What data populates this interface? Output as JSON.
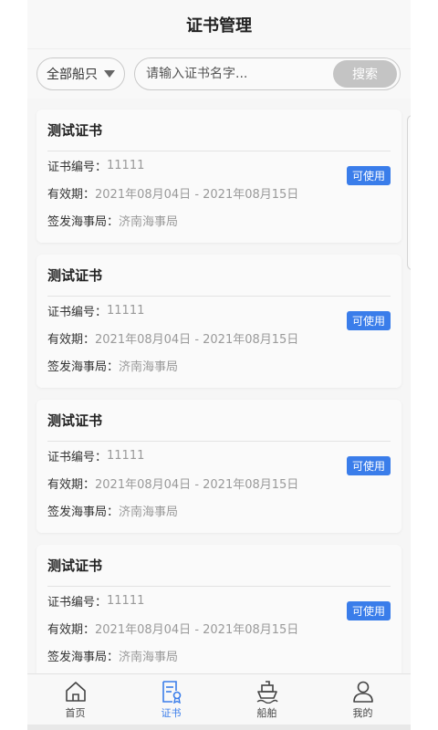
{
  "header": {
    "title": "证书管理"
  },
  "filter": {
    "ship_select": "全部船只",
    "search_placeholder": "请输入证书名字...",
    "search_button": "搜索"
  },
  "certificates": [
    {
      "title": "测试证书",
      "number_label": "证书编号：",
      "number": "11111",
      "validity_label": "有效期：",
      "validity": "2021年08月04日 - 2021年08月15日",
      "issuer_label": "签发海事局：",
      "issuer": "济南海事局",
      "status": "可使用"
    },
    {
      "title": "测试证书",
      "number_label": "证书编号：",
      "number": "11111",
      "validity_label": "有效期：",
      "validity": "2021年08月04日 - 2021年08月15日",
      "issuer_label": "签发海事局：",
      "issuer": "济南海事局",
      "status": "可使用"
    },
    {
      "title": "测试证书",
      "number_label": "证书编号：",
      "number": "11111",
      "validity_label": "有效期：",
      "validity": "2021年08月04日 - 2021年08月15日",
      "issuer_label": "签发海事局：",
      "issuer": "济南海事局",
      "status": "可使用"
    },
    {
      "title": "测试证书",
      "number_label": "证书编号：",
      "number": "11111",
      "validity_label": "有效期：",
      "validity": "2021年08月04日 - 2021年08月15日",
      "issuer_label": "签发海事局：",
      "issuer": "济南海事局",
      "status": "可使用"
    }
  ],
  "tabs": [
    {
      "label": "首页",
      "icon": "home-icon",
      "active": false
    },
    {
      "label": "证书",
      "icon": "certificate-icon",
      "active": true
    },
    {
      "label": "船舶",
      "icon": "ship-icon",
      "active": false
    },
    {
      "label": "我的",
      "icon": "user-icon",
      "active": false
    }
  ],
  "colors": {
    "accent": "#3a7dea",
    "badge": "#3a7dea",
    "search_button": "#c4c4c4"
  }
}
